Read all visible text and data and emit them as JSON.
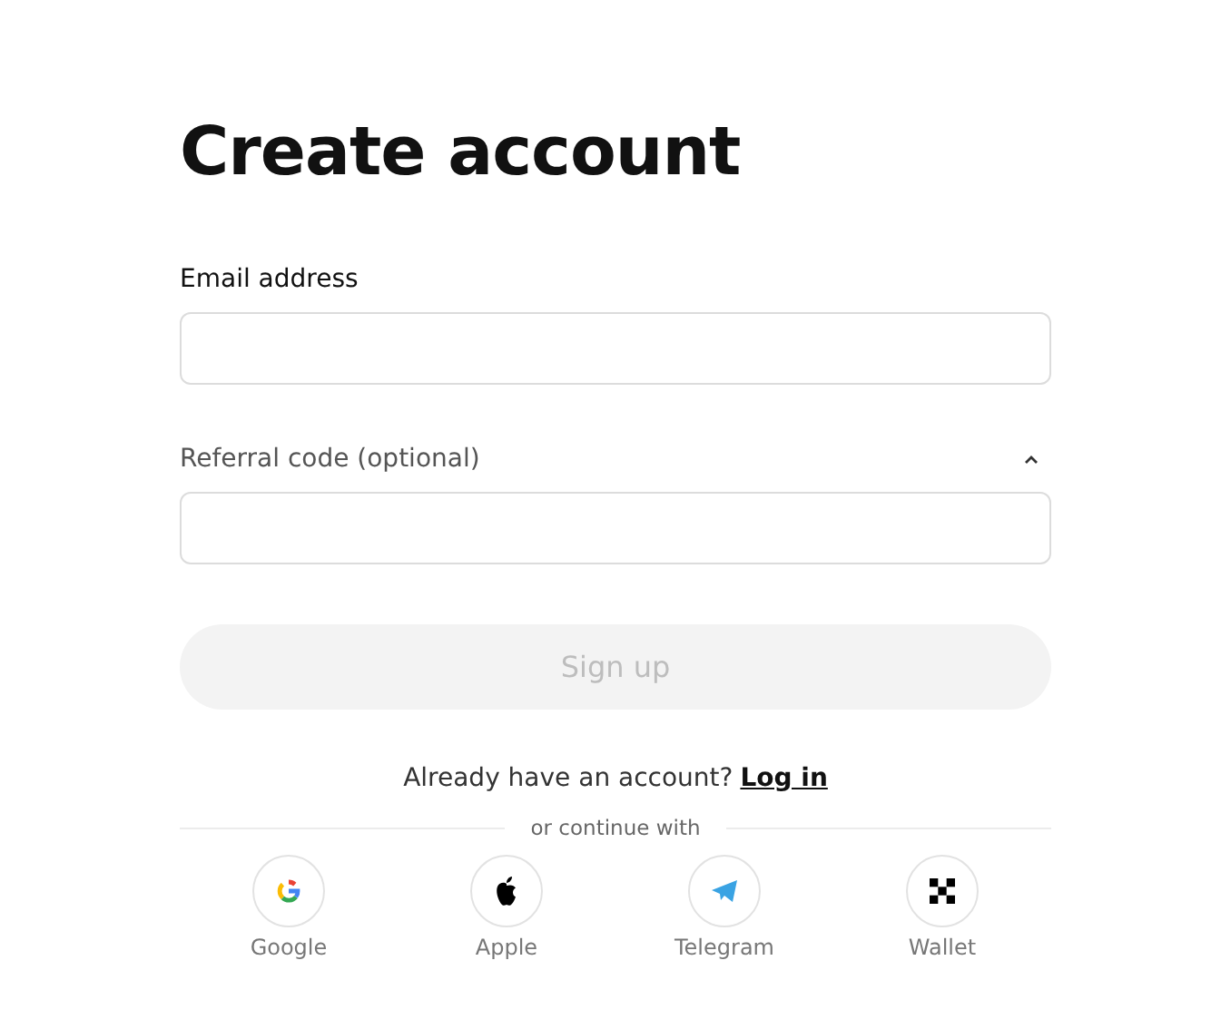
{
  "title": "Create account",
  "fields": [
    {
      "label": "Email address",
      "collapsible": false
    },
    {
      "label": "Referral code (optional)",
      "collapsible": true,
      "expanded": true
    }
  ],
  "submit": {
    "label": "Sign up",
    "disabled": true
  },
  "login_prompt": {
    "text": "Already have an account?",
    "link": "Log in"
  },
  "divider": "or continue with",
  "providers": [
    {
      "kind": "google",
      "label": "Google"
    },
    {
      "kind": "apple",
      "label": "Apple"
    },
    {
      "kind": "telegram",
      "label": "Telegram"
    },
    {
      "kind": "wallet",
      "label": "Wallet"
    }
  ]
}
